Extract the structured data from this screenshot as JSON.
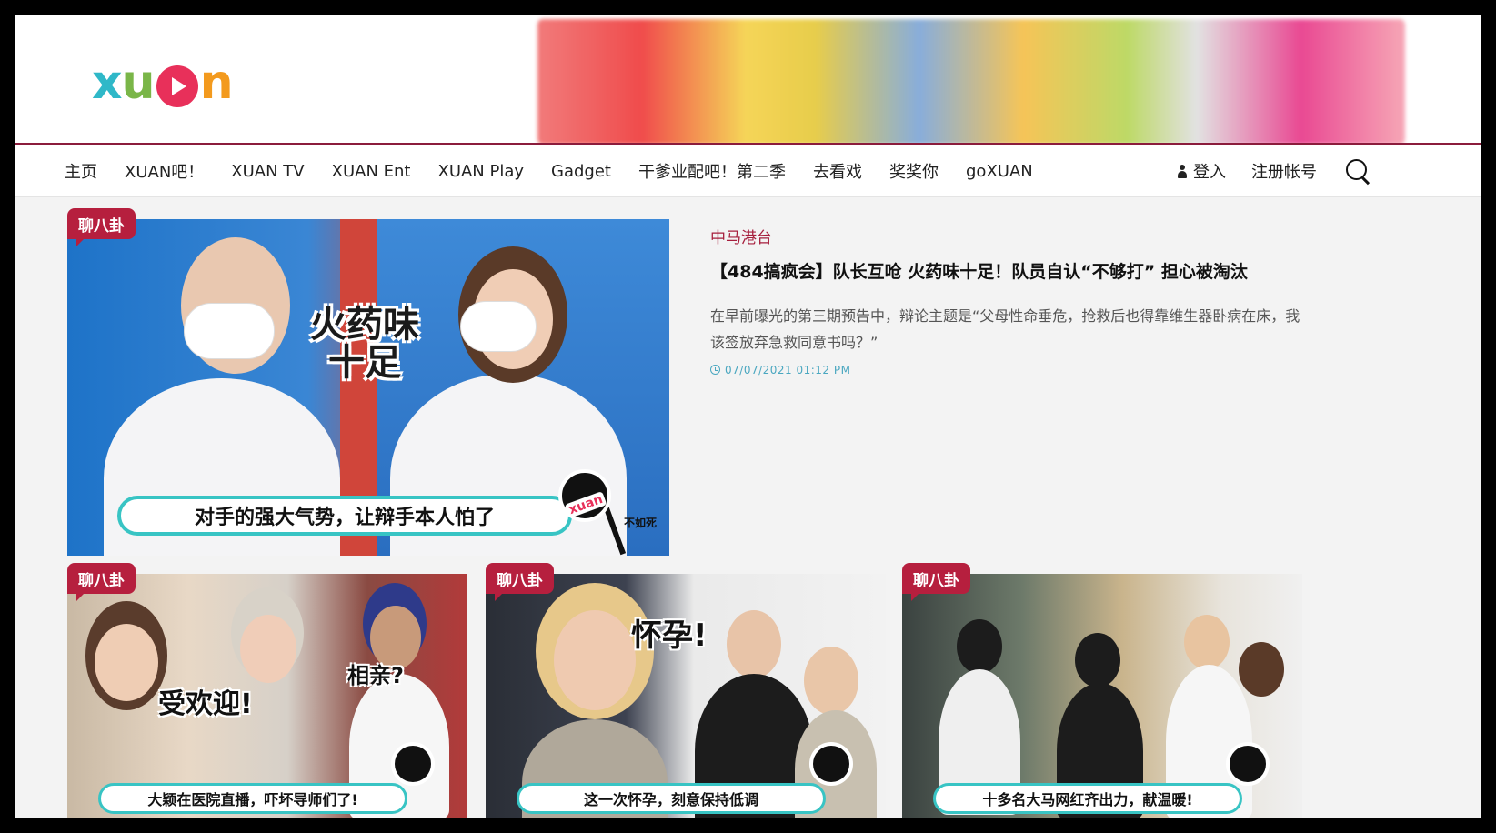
{
  "brand": {
    "logo_text": "xuan",
    "accent": "#b61f3e",
    "rule_color": "#8b1c3c"
  },
  "nav": {
    "items": [
      "主页",
      "XUAN吧！",
      "XUAN TV",
      "XUAN Ent",
      "XUAN Play",
      "Gadget",
      "干爹业配吧！第二季",
      "去看戏",
      "奖奖你",
      "goXUAN"
    ],
    "login": "登入",
    "register": "注册帐号"
  },
  "featured": {
    "tag": "聊八卦",
    "category": "中马港台",
    "title": "【484搞疯会】队长互呛 火药味十足！队员自认“不够打” 担心被淘汰",
    "description": "在早前曝光的第三期预告中，辩论主题是“父母性命垂危，抢救后也得靠维生器卧病在床，我该签放弃急救同意书吗？”",
    "date": "07/07/2021 01:12 PM",
    "image_overlay_text": "火药味十足",
    "image_caption": "对手的强大气势，让辩手本人怕了",
    "image_tag_small": "不如死"
  },
  "cards": [
    {
      "tag": "聊八卦",
      "overlay": "受欢迎!",
      "overlay2": "相亲?",
      "caption": "大颖在医院直播，吓坏导师们了!"
    },
    {
      "tag": "聊八卦",
      "overlay": "怀孕!",
      "overlay2": "",
      "caption": "这一次怀孕，刻意保持低调"
    },
    {
      "tag": "聊八卦",
      "overlay": "",
      "overlay2": "",
      "caption": "十多名大马网红齐出力，献温暖!"
    }
  ]
}
